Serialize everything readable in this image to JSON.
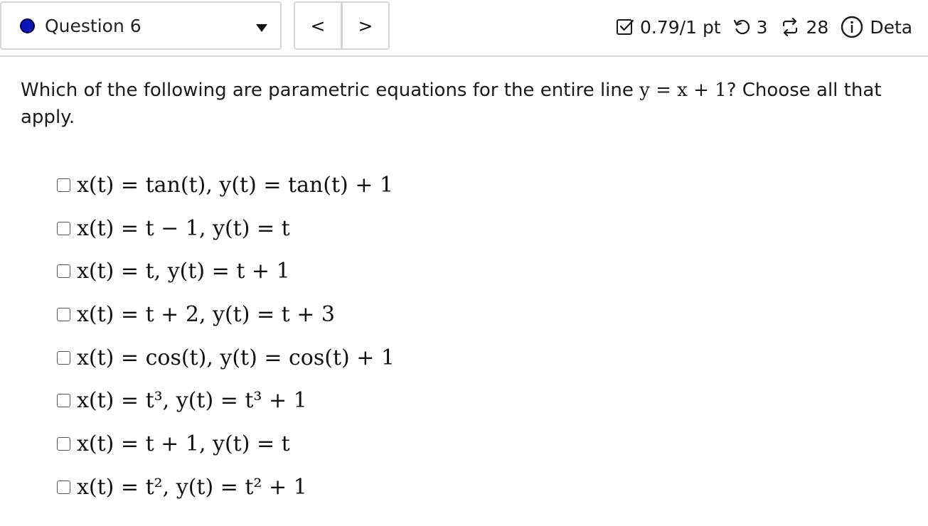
{
  "header": {
    "question_label": "Question 6",
    "status_color": "#0d14b8",
    "nav_prev": "<",
    "nav_next": ">",
    "score": "0.79/1 pt",
    "retries": "3",
    "attempts": "28",
    "details_label": "Deta"
  },
  "question": {
    "text_before": "Which of the following are parametric equations for the entire line ",
    "equation": "y = x + 1",
    "text_after": "? Choose all that apply."
  },
  "options": [
    "x(t) = tan(t), y(t) = tan(t) + 1",
    "x(t) = t − 1, y(t) = t",
    "x(t) = t, y(t) = t + 1",
    "x(t) = t + 2, y(t) = t + 3",
    "x(t) = cos(t), y(t) = cos(t) + 1",
    "x(t) = t³, y(t) = t³ + 1",
    "x(t) = t + 1, y(t) = t",
    "x(t) = t², y(t) = t² + 1"
  ]
}
